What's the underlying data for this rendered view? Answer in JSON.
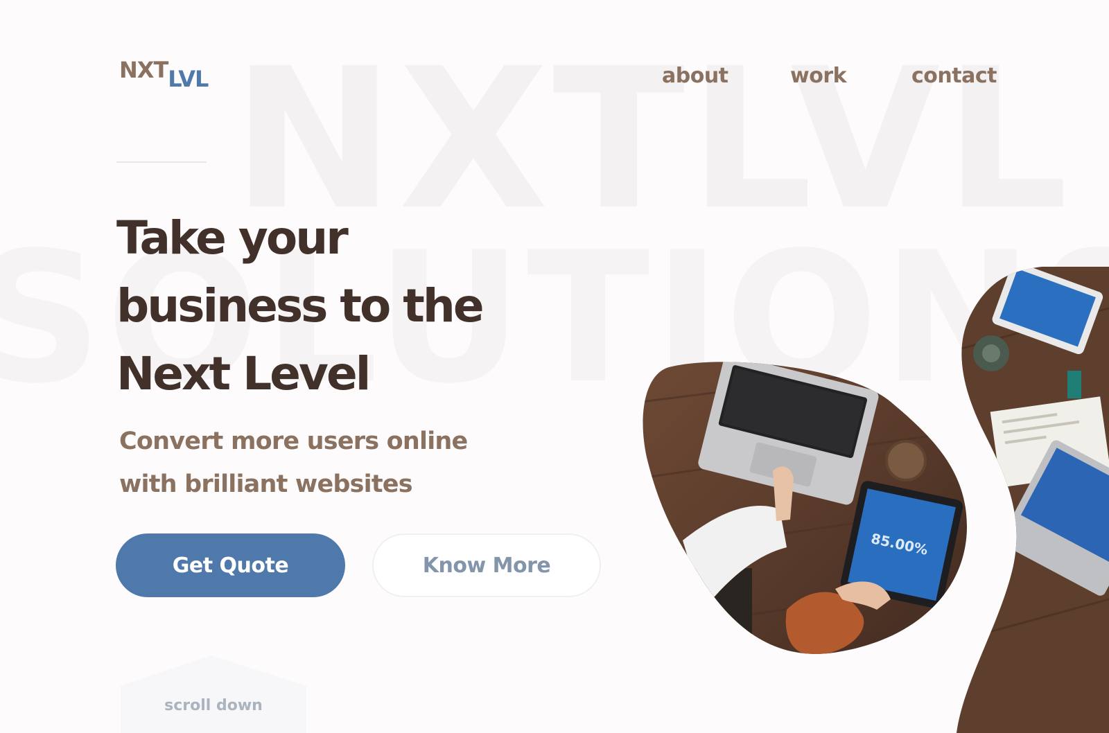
{
  "brand": {
    "part1": "NXT",
    "part2": "LVL"
  },
  "background_words": {
    "top": "NXTLVL",
    "middle": "SOLUTIONS"
  },
  "nav": {
    "items": [
      {
        "label": "about"
      },
      {
        "label": "work"
      },
      {
        "label": "contact"
      }
    ]
  },
  "hero": {
    "headline_lines": [
      "Take your",
      "business to the",
      "Next Level"
    ],
    "subheadline_lines": [
      "Convert more users online",
      "with brilliant websites"
    ]
  },
  "buttons": {
    "primary": "Get Quote",
    "secondary": "Know More"
  },
  "scroll": {
    "label": "scroll down"
  },
  "photo": {
    "tablet_readout": "85.00%"
  },
  "colors": {
    "brand_brown": "#8b7160",
    "brand_blue": "#4f79ab",
    "headline": "#42302a",
    "background": "#fdfbfc"
  }
}
